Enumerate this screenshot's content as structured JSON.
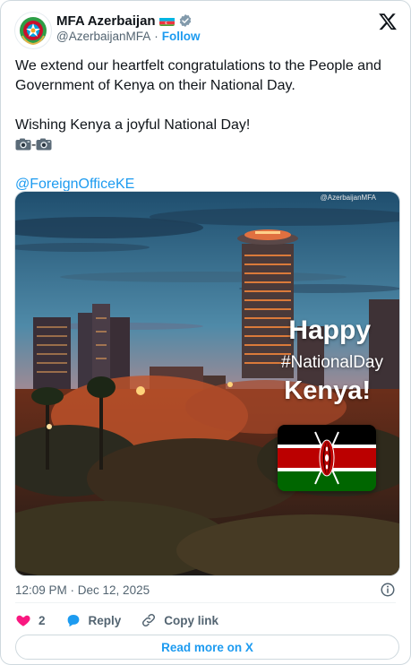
{
  "author": {
    "name": "MFA Azerbaijan",
    "handle": "@AzerbaijanMFA",
    "separator": "·",
    "follow_label": "Follow"
  },
  "tweet": {
    "line1": "We extend our heartfelt congratulations to the People and Government of Kenya on their National Day.",
    "line2": "Wishing Kenya a joyful National Day!",
    "camera_separator": "-",
    "mention": "@ForeignOfficeKE"
  },
  "media": {
    "watermark": "@AzerbaijanMFA",
    "happy": "Happy",
    "hashtag": "#NationalDay",
    "country": "Kenya!"
  },
  "meta": {
    "timestamp": "12:09 PM · Dec 12, 2025"
  },
  "actions": {
    "like_count": "2",
    "reply_label": "Reply",
    "copy_label": "Copy link"
  },
  "read_more_label": "Read more on X",
  "colors": {
    "accent": "#1d9bf0",
    "like": "#f91880",
    "text": "#0f1419",
    "muted": "#536471"
  },
  "icons": [
    "emblem-avatar-icon",
    "azerbaijan-flag-icon",
    "verified-icon",
    "x-logo-icon",
    "camera-icon",
    "kenya-flag-icon",
    "info-icon",
    "heart-icon",
    "reply-icon",
    "link-icon"
  ]
}
